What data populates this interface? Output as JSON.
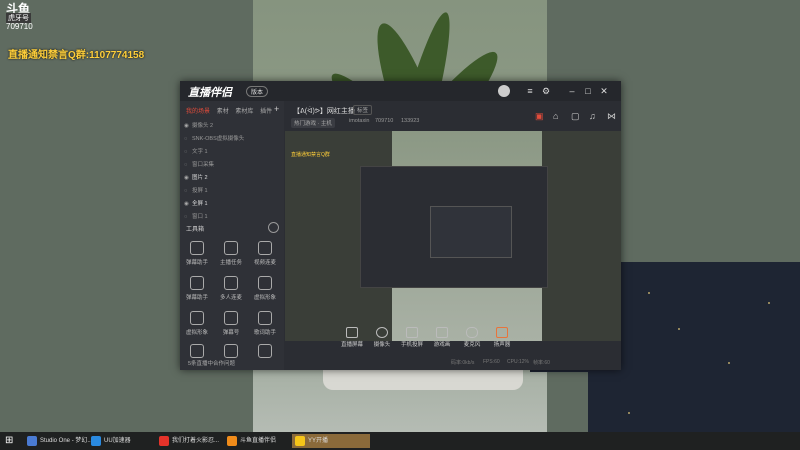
{
  "overlay": {
    "logo_text": "斗鱼",
    "logo_sub": "虎牙号",
    "room_num": "709710",
    "announce": "直播通知禁言Q群:1107774158"
  },
  "window": {
    "app_name": "直播伴侣",
    "version_badge": "版本",
    "tabs": [
      "我的场景",
      "素材",
      "素材库",
      "插件"
    ],
    "sources": [
      {
        "label": "摄像头 2",
        "visible": true
      },
      {
        "label": "SNK-OBS虚拟摄像头",
        "visible": false
      },
      {
        "label": "文字 1",
        "visible": false
      },
      {
        "label": "窗口采集",
        "visible": false
      },
      {
        "label": "图片 2",
        "visible": true
      },
      {
        "label": "投屏 1",
        "visible": false
      },
      {
        "label": "全屏 1",
        "visible": true
      },
      {
        "label": "窗口 1",
        "visible": false
      }
    ],
    "tools_title": "工具箱",
    "tools": [
      "弹幕助手",
      "主播任务",
      "视频连麦",
      "弹幕助手",
      "多人连麦",
      "虚拟形象",
      "虚拟形象",
      "弹幕号",
      "歌词助手",
      "",
      "",
      ""
    ],
    "bottom_note": "5条直播中合作问题",
    "room_title": "【ᕕ(ᐛ)ᕗ】网红主播",
    "room_tag": "标签",
    "room_category": "热门游戏 · 主机",
    "room_owner": "imotaxin",
    "room_id": "709710",
    "room_fans": "133923",
    "preview_banner": "直播通知禁言Q群",
    "controls": [
      "直播屏幕",
      "摄像头",
      "手机投屏",
      "游戏画",
      "麦克风",
      "扬声器"
    ],
    "stats": [
      "码率:0kb/s",
      "FPS:60",
      "CPU:12%",
      "帧率:60"
    ]
  },
  "taskbar": {
    "items": [
      {
        "label": "Studio One - 梦幻...",
        "color": "#4a7bd3"
      },
      {
        "label": "UU加速器",
        "color": "#2a8ae0"
      },
      {
        "label": "我们打着火影忍...",
        "color": "#e5332a"
      },
      {
        "label": "斗鱼直播伴侣",
        "color": "#f08c1a"
      },
      {
        "label": "YY开播",
        "color": "#f5c518"
      }
    ]
  }
}
